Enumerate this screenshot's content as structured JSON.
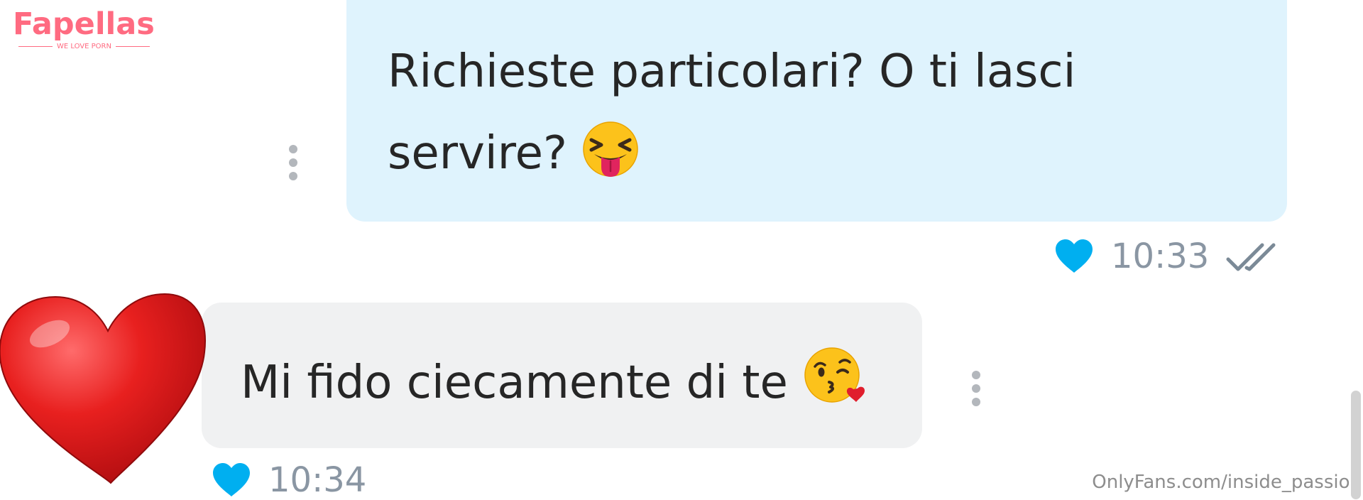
{
  "watermark": {
    "brand": "Fapellas",
    "tagline": "WE LOVE PORN"
  },
  "messages": [
    {
      "direction": "outgoing",
      "text": "Richieste particolari? O ti lasci servire?",
      "emoji": "squinting-face-with-tongue",
      "time": "10:33",
      "liked": true,
      "read_status": "double-check"
    },
    {
      "direction": "incoming",
      "text": "Mi fido ciecamente di te",
      "emoji": "face-blowing-a-kiss",
      "time": "10:34",
      "liked": true
    }
  ],
  "overlay": {
    "decoration": "red-heart"
  },
  "credit": "OnlyFans.com/inside_passion",
  "colors": {
    "outgoing_bubble": "#dff3fd",
    "incoming_bubble": "#f0f1f2",
    "like_heart": "#00aff0",
    "meta_text": "#8a96a3",
    "brand": "#ff6b81"
  }
}
